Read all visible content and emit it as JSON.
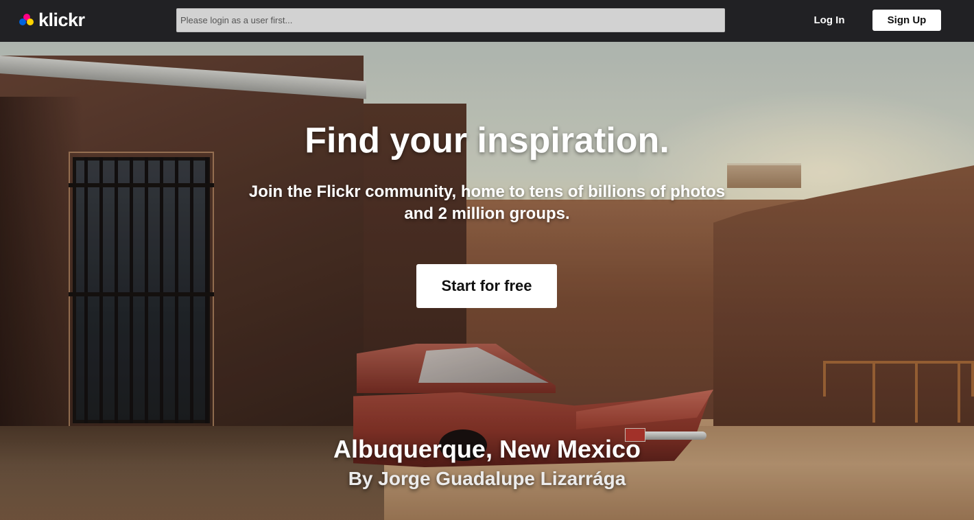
{
  "brand": {
    "name": "klickr",
    "dot_colors": [
      "#ff0084",
      "#0063dc",
      "#ffd400"
    ]
  },
  "header": {
    "search_placeholder": "Please login as a user first...",
    "login_label": "Log In",
    "signup_label": "Sign Up"
  },
  "hero": {
    "headline": "Find your inspiration.",
    "subheadline": "Join the Flickr community, home to tens of billions of photos and 2 million groups.",
    "cta_label": "Start for free",
    "photo_title": "Albuquerque, New Mexico",
    "photo_author": "By Jorge Guadalupe Lizarrága"
  },
  "colors": {
    "topbar_bg": "#212124",
    "button_bg": "#ffffff",
    "search_bg": "#d2d2d2"
  }
}
